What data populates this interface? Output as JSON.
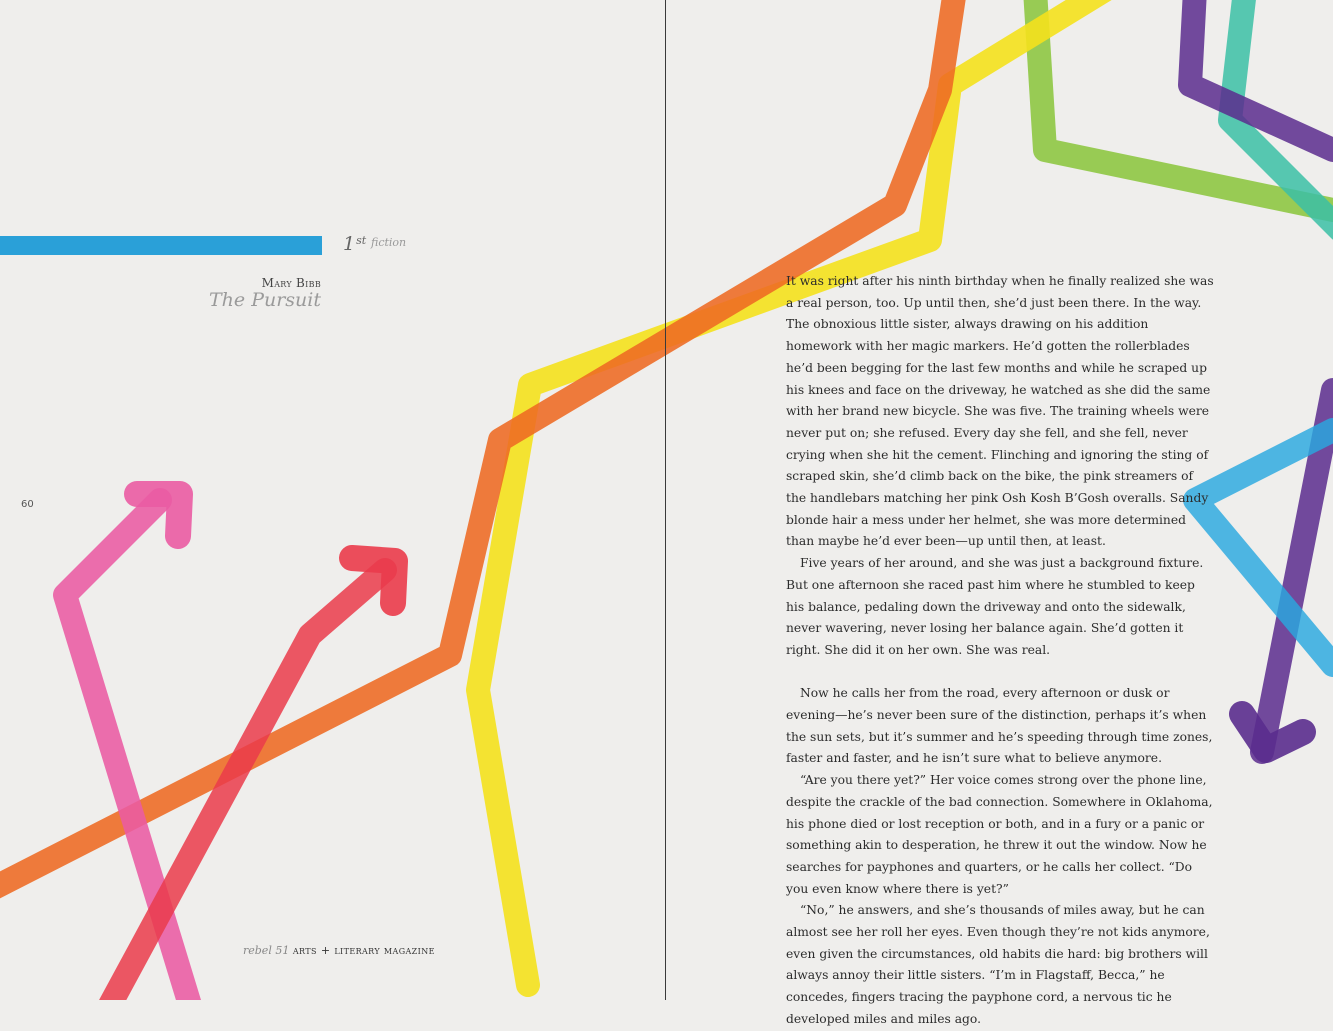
{
  "left_page": {
    "place": "1",
    "place_suffix": "st",
    "category": "fiction",
    "author": "Mary Bibb",
    "title": "The Pursuit",
    "page_number": "60",
    "footer": {
      "magazine_italic": "rebel 51",
      "magazine_caps": "arts + literary magazine"
    }
  },
  "right_page": {
    "paragraphs": [
      "It was right after his ninth birthday when he finally realized she was a real person, too. Up until then, she’d just been there. In the way. The obnoxious little sister, always drawing on his addition homework with her magic markers. He’d gotten the rollerblades he’d been begging for the last few months and while he scraped up his knees and face on the driveway, he watched as she did the same with her brand new bicycle. She was five. The training wheels were never put on; she refused. Every day she fell, and she fell, never crying when she hit the cement. Flinching and ignoring the sting of scraped skin, she’d climb back on the bike, the pink streamers of the handlebars matching her pink Osh Kosh B’Gosh overalls. Sandy blonde hair a mess under her helmet, she was more determined than maybe he’d ever been—up until then, at least.",
      "Five years of her around, and she was just a background fixture. But one afternoon she raced past him where he stumbled to keep his balance, pedaling down the driveway and onto the sidewalk, never wavering, never losing her balance again. She’d gotten it right. She did it on her own. She was real.",
      "Now he calls her from the road, every afternoon or dusk or evening—he’s never been sure of the distinction, perhaps it’s when the sun sets, but it’s summer and he’s speeding through time zones, faster and faster, and he isn’t sure what to believe anymore.",
      "“Are you there yet?” Her voice comes strong over the phone line, despite the crackle of the bad connection. Somewhere in Oklahoma, his phone died or lost reception or both, and in a fury or a panic or something akin to desperation, he threw it out the window. Now he searches for payphones and quarters, or he calls her collect. “Do you even know where there is yet?”",
      "“No,” he answers, and she’s thousands of miles away, but he can almost see her roll her eyes. Even though they’re not kids anymore, even given the circumstances, old habits die hard: big brothers will always annoy their little sisters. “I’m in Flagstaff, Becca,” he concedes, fingers tracing the payphone cord, a nervous tic he developed miles and miles ago."
    ]
  },
  "colors": {
    "blue": "#2aa0d8",
    "orange": "#ee6a22",
    "yellow": "#f4e11d",
    "pink": "#ea5ba3",
    "red": "#ea3b4b",
    "green": "#8cc63f",
    "teal": "#3bbfa6",
    "purple": "#5a2c8e",
    "sky": "#29a8df"
  },
  "icons": [
    "arrow-up-right-icon",
    "arrow-down-icon"
  ]
}
